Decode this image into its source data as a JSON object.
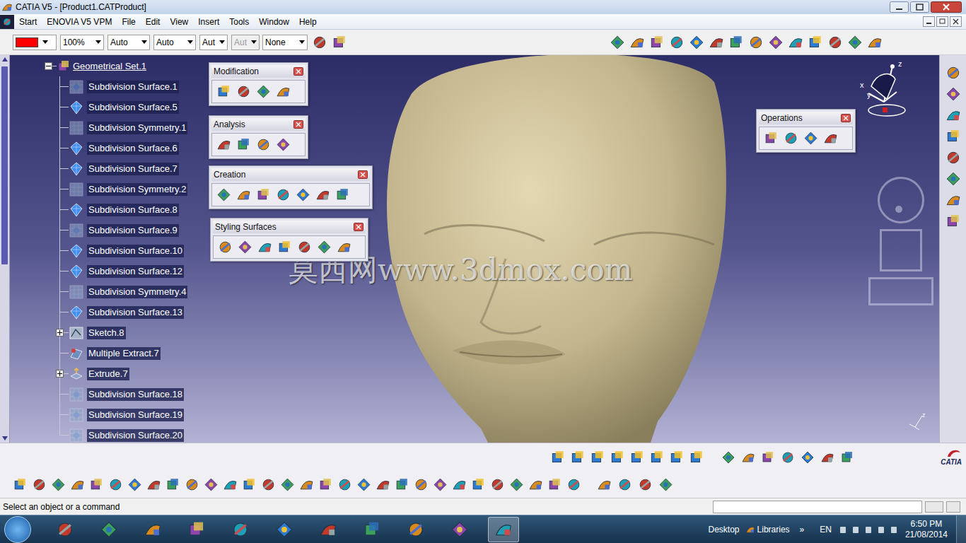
{
  "window": {
    "title": "CATIA V5 - [Product1.CATProduct]"
  },
  "menu": [
    {
      "label": "Start"
    },
    {
      "label": "ENOVIA V5 VPM"
    },
    {
      "label": "File"
    },
    {
      "label": "Edit"
    },
    {
      "label": "View"
    },
    {
      "label": "Insert"
    },
    {
      "label": "Tools"
    },
    {
      "label": "Window"
    },
    {
      "label": "Help"
    }
  ],
  "format_toolbar": {
    "color": "#ff0000",
    "zoom": "100%",
    "fields": [
      {
        "value": "Auto",
        "disabled": false
      },
      {
        "value": "Auto",
        "disabled": false
      },
      {
        "value": "Aut",
        "disabled": false
      },
      {
        "value": "Aut",
        "disabled": true
      }
    ],
    "layer": "None"
  },
  "tree": {
    "root": {
      "label": "Geometrical Set.1",
      "expanded": true
    },
    "items": [
      {
        "label": "Subdivision Surface.1",
        "kind": "surface",
        "hidden": true,
        "expandable": false
      },
      {
        "label": "Subdivision Surface.5",
        "kind": "surface",
        "hidden": false,
        "expandable": false
      },
      {
        "label": "Subdivision Symmetry.1",
        "kind": "symmetry",
        "hidden": true,
        "expandable": false
      },
      {
        "label": "Subdivision Surface.6",
        "kind": "surface",
        "hidden": false,
        "expandable": false
      },
      {
        "label": "Subdivision Surface.7",
        "kind": "surface",
        "hidden": false,
        "expandable": false
      },
      {
        "label": "Subdivision Symmetry.2",
        "kind": "symmetry",
        "hidden": true,
        "expandable": false
      },
      {
        "label": "Subdivision Surface.8",
        "kind": "surface",
        "hidden": false,
        "expandable": false
      },
      {
        "label": "Subdivision Surface.9",
        "kind": "surface",
        "hidden": true,
        "expandable": false
      },
      {
        "label": "Subdivision Surface.10",
        "kind": "surface",
        "hidden": false,
        "expandable": false
      },
      {
        "label": "Subdivision Surface.12",
        "kind": "surface",
        "hidden": false,
        "expandable": false
      },
      {
        "label": "Subdivision Symmetry.4",
        "kind": "symmetry",
        "hidden": true,
        "expandable": false
      },
      {
        "label": "Subdivision Surface.13",
        "kind": "surface",
        "hidden": false,
        "expandable": false
      },
      {
        "label": "Sketch.8",
        "kind": "sketch",
        "hidden": false,
        "expandable": true
      },
      {
        "label": "Multiple Extract.7",
        "kind": "extract",
        "hidden": false,
        "expandable": false
      },
      {
        "label": "Extrude.7",
        "kind": "extrude",
        "hidden": false,
        "expandable": true
      },
      {
        "label": "Subdivision Surface.18",
        "kind": "surface",
        "hidden": true,
        "expandable": false
      },
      {
        "label": "Subdivision Surface.19",
        "kind": "surface",
        "hidden": true,
        "expandable": false
      },
      {
        "label": "Subdivision Surface.20",
        "kind": "surface",
        "hidden": true,
        "expandable": false
      }
    ]
  },
  "floating_toolbars": [
    {
      "title": "Modification"
    },
    {
      "title": "Analysis"
    },
    {
      "title": "Creation"
    },
    {
      "title": "Styling Surfaces"
    },
    {
      "title": "Operations"
    }
  ],
  "watermark": "莫西网www.3dmox.com",
  "compass": {
    "axes": [
      "z",
      "x",
      "y"
    ]
  },
  "mini_axis": {
    "label": "z"
  },
  "logo": {
    "text": "CATIA"
  },
  "status_bar": {
    "message": "Select an object or a command"
  },
  "taskbar": {
    "apps": [
      {
        "selected": false
      },
      {
        "selected": false
      },
      {
        "selected": false
      },
      {
        "selected": false
      },
      {
        "selected": false
      },
      {
        "selected": false
      },
      {
        "selected": false
      },
      {
        "selected": false
      },
      {
        "selected": false
      },
      {
        "selected": false
      },
      {
        "selected": true
      }
    ],
    "desktop": "Desktop",
    "libraries": "Libraries",
    "more": "»",
    "language": "EN",
    "time": "6:50 PM",
    "date": "21/08/2014"
  }
}
